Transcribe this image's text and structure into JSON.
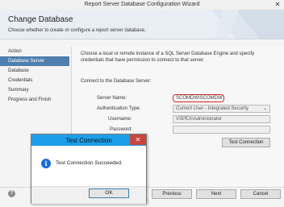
{
  "window": {
    "title": "Report Server Database Configuration Wizard",
    "close_glyph": "✕"
  },
  "header": {
    "title": "Change Database",
    "subtitle": "Choose whether to create or configure a report server database."
  },
  "sidebar": {
    "items": [
      {
        "label": "Action",
        "active": false
      },
      {
        "label": "Database Server",
        "active": true
      },
      {
        "label": "Database",
        "active": false
      },
      {
        "label": "Credentials",
        "active": false
      },
      {
        "label": "Summary",
        "active": false
      },
      {
        "label": "Progress and Finish",
        "active": false
      }
    ]
  },
  "content": {
    "description": "Choose a local or remote instance of a SQL Server Database Engine and specify credentials that have permission to connect to that server.",
    "section_label": "Connect to the Database Server:",
    "server_name": {
      "label": "Server Name:",
      "value": "SCOMDW\\SCOMDW"
    },
    "auth_type": {
      "label": "Authentication Type:",
      "value": "Current User - Integrated Security"
    },
    "username": {
      "label": "Username:",
      "value": "VSPEX\\Administrator"
    },
    "password": {
      "label": "Password:",
      "value": ""
    },
    "test_button": "Test Connection"
  },
  "footer": {
    "help": "?",
    "previous": "Previous",
    "next": "Next",
    "cancel": "Cancel"
  },
  "dialog": {
    "title": "Test Connection",
    "close_glyph": "✕",
    "message": "Test Connection Succeeded.",
    "info_glyph": "i",
    "ok": "OK"
  },
  "colors": {
    "accent_selected": "#4f7fae",
    "dialog_title": "#1c9fe8",
    "close_red": "#c7473e",
    "highlight_red": "#cc2222"
  }
}
